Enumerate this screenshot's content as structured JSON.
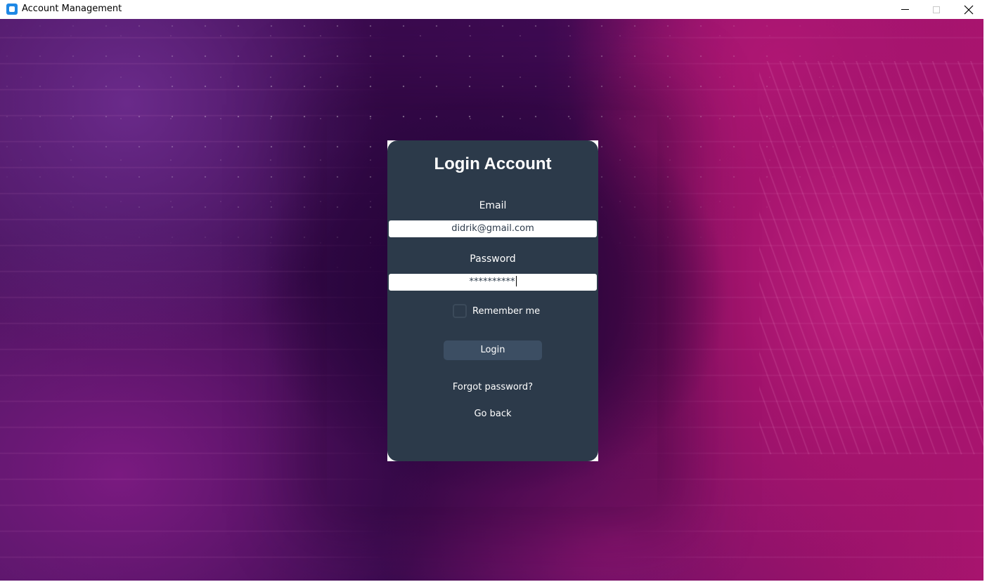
{
  "window": {
    "title": "Account Management",
    "controls": [
      "minimize",
      "maximize",
      "close"
    ]
  },
  "login": {
    "heading": "Login Account",
    "email_label": "Email",
    "email_value": "didrik@gmail.com",
    "password_label": "Password",
    "password_value": "**********",
    "remember_label": "Remember me",
    "remember_checked": false,
    "login_button": "Login",
    "forgot_link": "Forgot password?",
    "back_link": "Go back"
  },
  "colors": {
    "card_background": "#2c3a4a",
    "button_background": "#3c4e63",
    "text": "#ffffff",
    "background_accent": "#a8146e"
  },
  "icons": {
    "app": "app-icon",
    "minimize": "minimize-icon",
    "maximize": "maximize-icon",
    "close": "close-icon"
  }
}
